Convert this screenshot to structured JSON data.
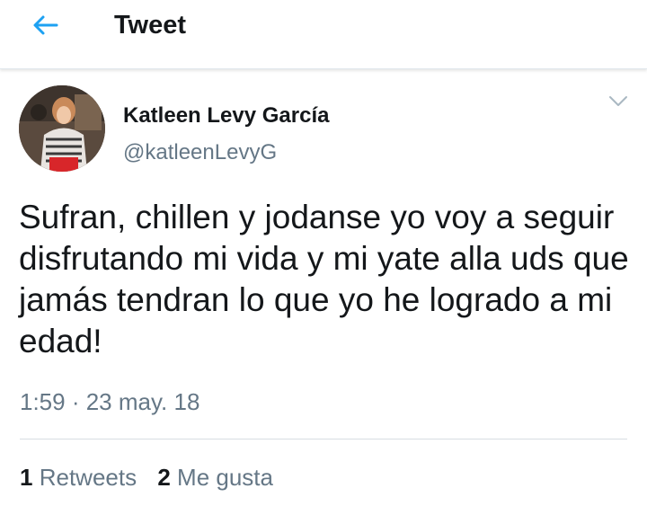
{
  "header": {
    "title": "Tweet",
    "back_icon": "back-arrow-icon",
    "accent_color": "#1da1f2"
  },
  "tweet": {
    "author_name": "Katleen Levy García",
    "author_handle": "@katleenLevyG",
    "caret_icon": "chevron-down-icon",
    "text": "Sufran, chillen y jodanse yo voy a seguir disfrutando mi vida y mi yate alla uds que jamás tendran lo que yo he logrado a mi edad!",
    "timestamp": "1:59 · 23 may. 18",
    "stats": {
      "retweets_count": "1",
      "retweets_label": "Retweets",
      "likes_count": "2",
      "likes_label": "Me gusta"
    }
  }
}
